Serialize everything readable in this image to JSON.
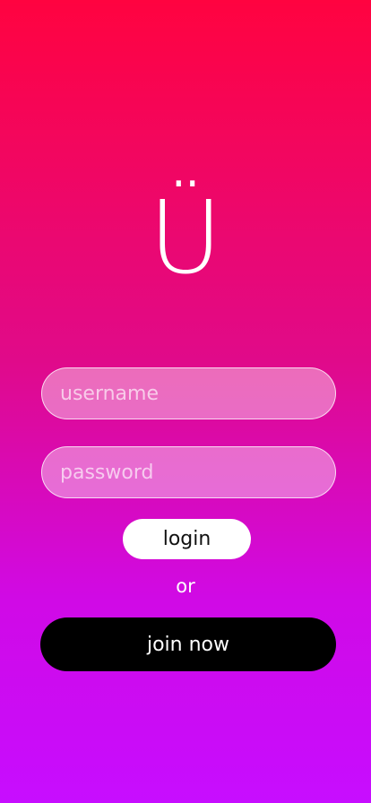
{
  "logo": {
    "glyph": "Ü"
  },
  "form": {
    "username_placeholder": "username",
    "password_placeholder": "password",
    "login_label": "login",
    "or_text": "or",
    "join_label": "join now"
  },
  "colors": {
    "gradient_top": "#ff0340",
    "gradient_bottom": "#c70dff",
    "login_button_bg": "#ffffff",
    "join_button_bg": "#000000"
  }
}
